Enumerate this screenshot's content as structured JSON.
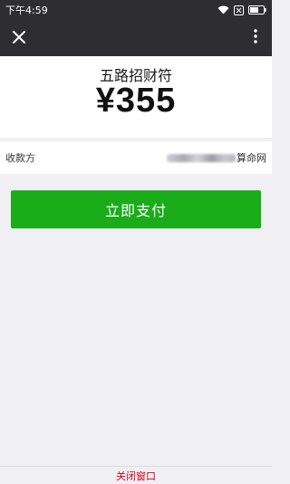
{
  "status_bar": {
    "time": "下午4:59",
    "battery_label": "54"
  },
  "nav": {
    "close_icon": "close-icon",
    "more_icon": "more-vertical-icon"
  },
  "payment": {
    "product_name": "五路招财符",
    "price": "¥355",
    "payee_label": "收款方",
    "payee_suffix": "算命网"
  },
  "pay_button": {
    "label": "立即支付",
    "color": "#1aad19"
  },
  "footer": {
    "close_window_label": "关闭窗口",
    "close_window_color": "#d0021b"
  }
}
